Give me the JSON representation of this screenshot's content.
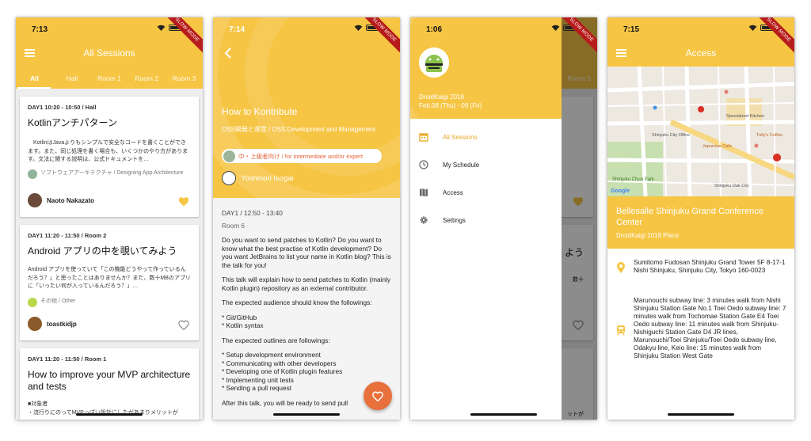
{
  "colors": {
    "primary": "#f6c544",
    "accent": "#e8703c",
    "favorite": "#f6c544"
  },
  "slow_mode_label": "SLOW MODE",
  "sessions_screen": {
    "time": "7:13",
    "title": "All Sessions",
    "tabs": [
      "All",
      "Hall",
      "Room 1",
      "Room 2",
      "Room 3"
    ],
    "cards": [
      {
        "meta": "DAY1   10:20 - 10:50 / Hall",
        "title": "Kotlinアンチパターン",
        "desc": "　KotlinはJavaよりもシンプルで安全なコードを書くことができます。また、同じ処理を書く場合も、いくつかのやり方があります。文法に関する説明は、公式ドキュメントを…",
        "topic": "ソフトウェアアーキテクチャ / Designing App Architecture",
        "speaker": "Naoto Nakazato",
        "favorite": true
      },
      {
        "meta": "DAY1   11:20 - 11:50 / Room 2",
        "title": "Android アプリの中を覗いてみよう",
        "desc": "Android アプリを使っていて「この機能どうやって作っているんだろう？」と思ったことはありませんか？また、数十MBのアプリに「いったい何が入っているんだろう？」…",
        "topic": "その他 / Other",
        "speaker": "toastkidjp",
        "favorite": false
      },
      {
        "meta": "DAY1   11:20 - 11:50 / Room 1",
        "title": "How to improve your MVP architecture and tests",
        "desc": "■対象者\n・流行りにのってMVPっぽい設計にしたがあまりメリットが"
      }
    ]
  },
  "detail_screen": {
    "time": "7:14",
    "title": "How to Kontribute",
    "topic": "OSS開発と運営 / OSS Development and Management",
    "level": "中・上級者向け / for intermediate and/or expert",
    "speaker": "Yoshinori Isogai",
    "when": "DAY1 / 12:50 - 13:40",
    "room": "Room 6",
    "paragraphs": [
      "Do you want to send patches to Kotlin? Do you want to know what the best practise of Kotlin development? Do you want JetBrains to list your name in Kotlin blog? This is the talk for you!",
      "This talk will explain how to send patches to Kotlin (mainly Kotlin plugin) repository as an external contributor.",
      "The expected audience should know the followings:",
      "* Git/GitHub\n* Kotlin syntax",
      "The expected outlines are followings:",
      "* Setup development environment\n* Communicating with other developers\n* Developing one of Kotlin plugin features\n* Implementing unit tests\n* Sending a pull request",
      "After this talk, you will be ready to send pull"
    ]
  },
  "drawer_screen": {
    "time": "1:06",
    "app_name": "DroidKaigi 2018",
    "dates": "Feb.08 (Thu) - 09 (Fri)",
    "items": [
      {
        "label": "All Sessions",
        "icon": "calendar-icon",
        "active": true
      },
      {
        "label": "My Schedule",
        "icon": "clock-icon",
        "active": false
      },
      {
        "label": "Access",
        "icon": "map-icon",
        "active": false
      },
      {
        "label": "Settings",
        "icon": "gear-icon",
        "active": false
      }
    ],
    "bg_tab": "Room 3",
    "bg_texts": [
      "よう",
      "数十",
      "ットが"
    ]
  },
  "access_screen": {
    "time": "7:15",
    "title": "Access",
    "venue": "Bellesalle Shinjuku Grand Conference Center",
    "venue_sub": "DroidKaigi 2018 Place",
    "address": "Sumitomo Fudosan Shinjuku Grand Tower 5F 8-17-1 Nishi Shinjuku, Shinjuku City, Tokyo 160-0023",
    "transit": "Marunouchi subway line: 3 minutes walk from Nishi Shinjuku Station Gate No.1 Toei Oedo subway line: 7 minutes walk from Tochomae Station Gate E4 Toei Oedo subway line: 11 minutes walk from Shinjuku-Nishiguchi Station Gate D4 JR lines, Marunouchi/Toei Shinjuku/Toei Oedo subway line, Odakyu line, Keio line: 15 minutes walk from Shinjuku Station West Gate",
    "map_labels": [
      "Shinjuku Chuo Park",
      "Shinjuku City Office",
      "Specialized Kitchen",
      "Japanese Cafe",
      "Tully's Coffee",
      "Shinjuku Oak City",
      "Google"
    ]
  }
}
